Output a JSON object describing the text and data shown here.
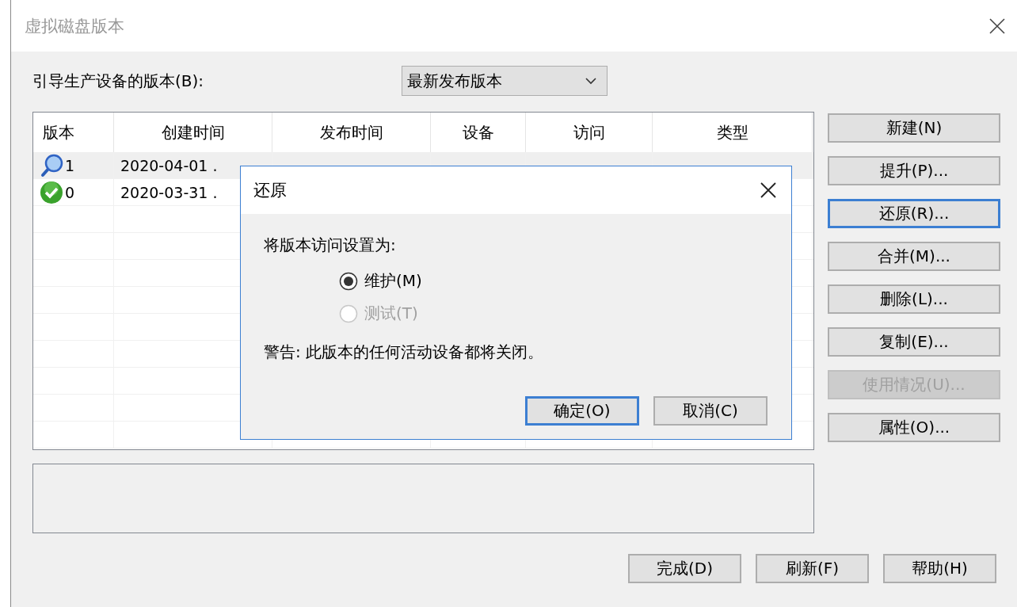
{
  "window": {
    "title": "虚拟磁盘版本",
    "active": false
  },
  "boot_version": {
    "label": "引导生产设备的版本(B):",
    "value": "最新发布版本"
  },
  "table": {
    "columns": [
      "版本",
      "创建时间",
      "发布时间",
      "设备",
      "访问",
      "类型"
    ],
    "rows": [
      {
        "kind": "test",
        "version": "1",
        "created": "2020-04-01 .",
        "selected": true
      },
      {
        "kind": "production",
        "version": "0",
        "created": "2020-03-31 .",
        "selected": false
      }
    ]
  },
  "side_buttons": [
    {
      "label": "新建(N)",
      "default": false,
      "disabled": false
    },
    {
      "label": "提升(P)...",
      "default": false,
      "disabled": false
    },
    {
      "label": "还原(R)...",
      "default": true,
      "disabled": false
    },
    {
      "label": "合并(M)...",
      "default": false,
      "disabled": false
    },
    {
      "label": "删除(L)...",
      "default": false,
      "disabled": false
    },
    {
      "label": "复制(E)...",
      "default": false,
      "disabled": false
    },
    {
      "label": "使用情况(U)...",
      "default": false,
      "disabled": true
    },
    {
      "label": "属性(O)...",
      "default": false,
      "disabled": false
    }
  ],
  "bottom_buttons": [
    {
      "label": "完成(D)"
    },
    {
      "label": "刷新(F)"
    },
    {
      "label": "帮助(H)"
    }
  ],
  "restore_dialog": {
    "title": "还原",
    "prompt": "将版本访问设置为:",
    "options": [
      {
        "label": "维护(M)",
        "selected": true,
        "disabled": false
      },
      {
        "label": "测试(T)",
        "selected": false,
        "disabled": true
      }
    ],
    "warning": "警告: 此版本的任何活动设备都将关闭。",
    "buttons": [
      {
        "label": "确定(O)",
        "default": true
      },
      {
        "label": "取消(C)",
        "default": false
      }
    ]
  }
}
